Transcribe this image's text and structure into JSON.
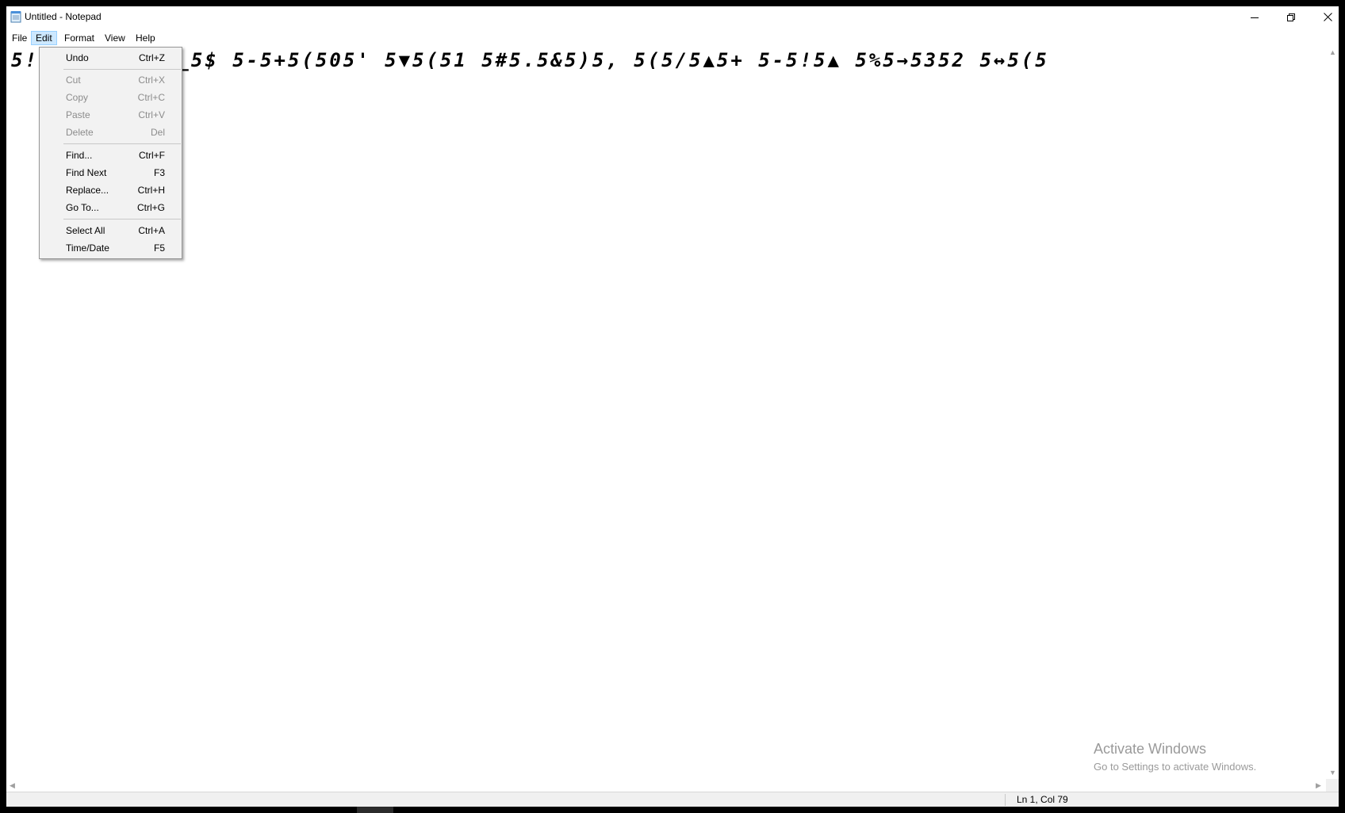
{
  "window": {
    "title": "Untitled - Notepad",
    "icons": {
      "app": "notepad-icon",
      "minimize": "minimize-icon",
      "maximize": "restore-icon",
      "close": "close-icon"
    }
  },
  "menubar": {
    "items": [
      {
        "label": "File"
      },
      {
        "label": "Edit",
        "active": true
      },
      {
        "label": "Format"
      },
      {
        "label": "View"
      },
      {
        "label": "Help"
      }
    ]
  },
  "editor": {
    "text": "5!        '5_5$ 5-5+5(505' 5▼5(51 5#5.5&5)5, 5(5/5▲5+ 5-5!5▲ 5%5→5352 5↔5(5"
  },
  "edit_menu": {
    "items": [
      {
        "label": "Undo",
        "shortcut": "Ctrl+Z",
        "enabled": true
      },
      {
        "label": "Cut",
        "shortcut": "Ctrl+X",
        "enabled": false
      },
      {
        "label": "Copy",
        "shortcut": "Ctrl+C",
        "enabled": false
      },
      {
        "label": "Paste",
        "shortcut": "Ctrl+V",
        "enabled": false
      },
      {
        "label": "Delete",
        "shortcut": "Del",
        "enabled": false
      },
      {
        "label": "Find...",
        "shortcut": "Ctrl+F",
        "enabled": true
      },
      {
        "label": "Find Next",
        "shortcut": "F3",
        "enabled": true
      },
      {
        "label": "Replace...",
        "shortcut": "Ctrl+H",
        "enabled": true
      },
      {
        "label": "Go To...",
        "shortcut": "Ctrl+G",
        "enabled": true
      },
      {
        "label": "Select All",
        "shortcut": "Ctrl+A",
        "enabled": true
      },
      {
        "label": "Time/Date",
        "shortcut": "F5",
        "enabled": true
      }
    ]
  },
  "status": {
    "position": "Ln 1, Col 79"
  },
  "watermark": {
    "title": "Activate Windows",
    "subtitle": "Go to Settings to activate Windows."
  },
  "colors": {
    "menu_highlight": "#cce8ff",
    "menu_highlight_border": "#99d1ff",
    "disabled_text": "#8c8c8c"
  }
}
